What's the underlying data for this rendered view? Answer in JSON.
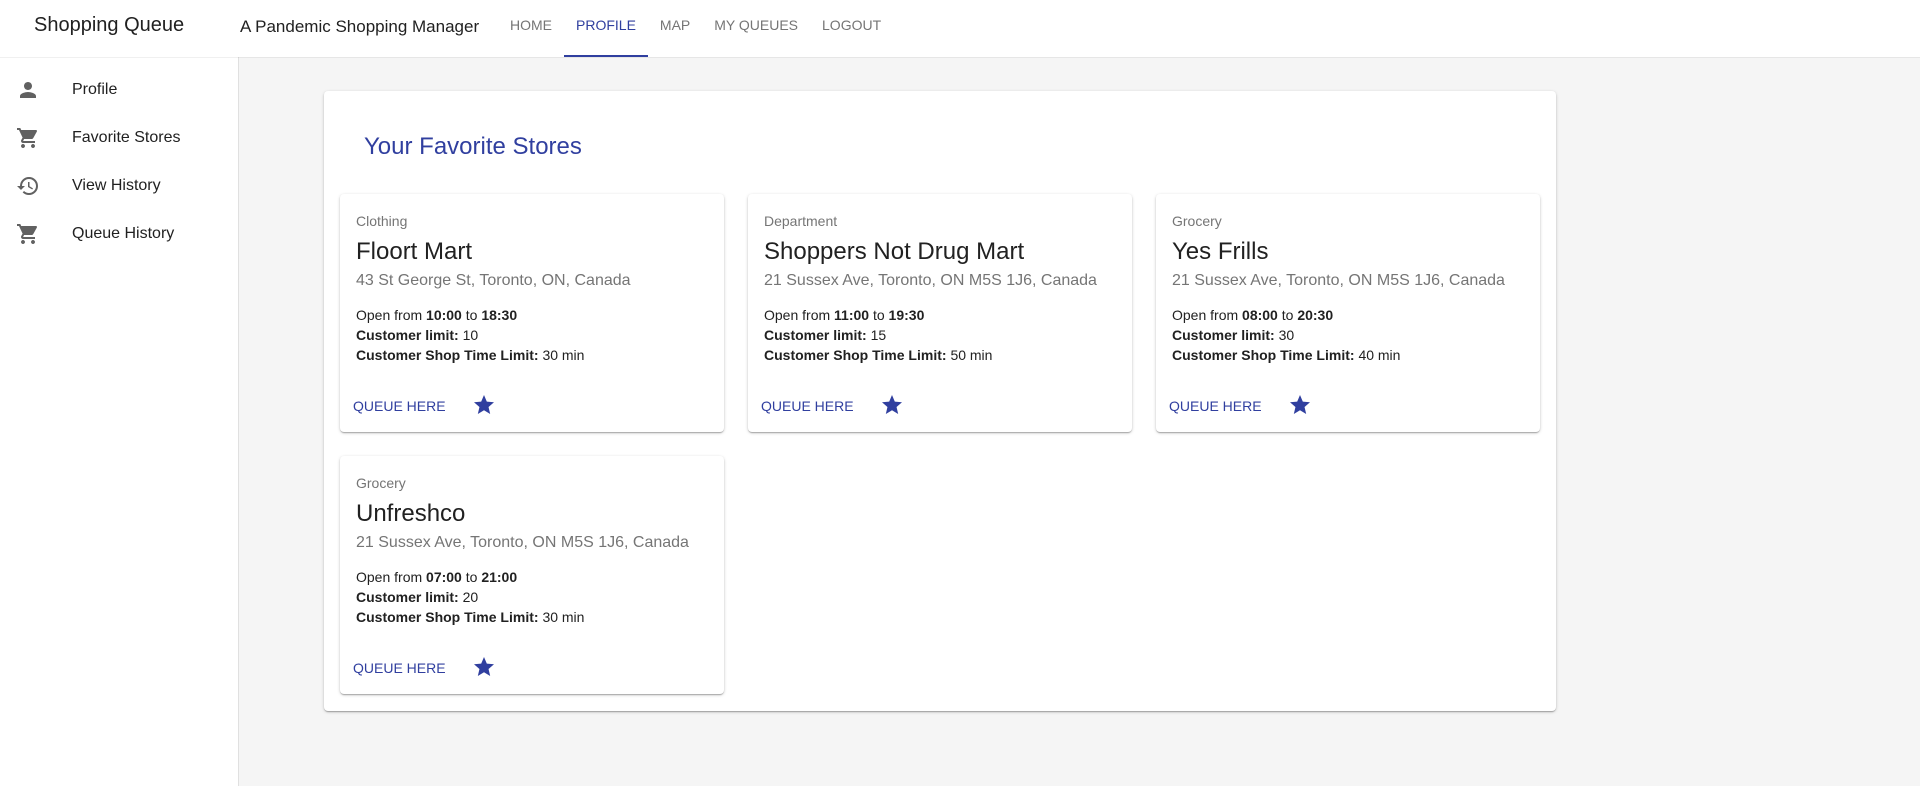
{
  "app": {
    "title": "Shopping Queue",
    "subtitle": "A Pandemic Shopping Manager"
  },
  "nav": {
    "tabs": [
      {
        "label": "HOME",
        "active": false
      },
      {
        "label": "PROFILE",
        "active": true
      },
      {
        "label": "MAP",
        "active": false
      },
      {
        "label": "MY QUEUES",
        "active": false
      },
      {
        "label": "LOGOUT",
        "active": false
      }
    ]
  },
  "sidebar": {
    "items": [
      {
        "label": "Profile",
        "icon": "person-icon"
      },
      {
        "label": "Favorite Stores",
        "icon": "cart-icon"
      },
      {
        "label": "View History",
        "icon": "history-icon"
      },
      {
        "label": "Queue History",
        "icon": "cart-icon"
      }
    ]
  },
  "main": {
    "title": "Your Favorite Stores",
    "common": {
      "open_from": "Open from",
      "to": "to",
      "customer_limit_label": "Customer limit:",
      "shop_time_label": "Customer Shop Time Limit:",
      "queue_label": "QUEUE HERE",
      "star_icon": "star-icon"
    },
    "stores": [
      {
        "category": "Clothing",
        "name": "Floort Mart",
        "address": "43 St George St, Toronto, ON, Canada",
        "open": "10:00",
        "close": "18:30",
        "limit": "10",
        "time_limit": "30 min"
      },
      {
        "category": "Department",
        "name": "Shoppers Not Drug Mart",
        "address": "21 Sussex Ave, Toronto, ON M5S 1J6, Canada",
        "open": "11:00",
        "close": "19:30",
        "limit": "15",
        "time_limit": "50 min"
      },
      {
        "category": "Grocery",
        "name": "Yes Frills",
        "address": "21 Sussex Ave, Toronto, ON M5S 1J6, Canada",
        "open": "08:00",
        "close": "20:30",
        "limit": "30",
        "time_limit": "40 min"
      },
      {
        "category": "Grocery",
        "name": "Unfreshco",
        "address": "21 Sussex Ave, Toronto, ON M5S 1J6, Canada",
        "open": "07:00",
        "close": "21:00",
        "limit": "20",
        "time_limit": "30 min"
      }
    ]
  },
  "colors": {
    "primary": "#303f9f",
    "background": "#f5f5f5",
    "secondary_text": "#757575",
    "icon": "#616161"
  }
}
